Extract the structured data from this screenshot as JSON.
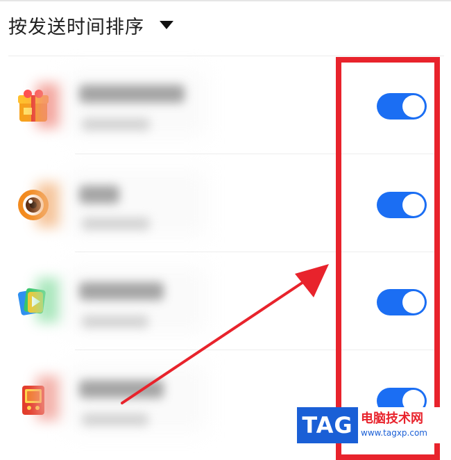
{
  "sort": {
    "label": "按发送时间排序",
    "caret_icon": "caret-down-icon"
  },
  "apps": [
    {
      "icon": "gift-box-app-icon",
      "notifications_enabled": true,
      "accent": "#f5a623"
    },
    {
      "icon": "eye-app-icon",
      "notifications_enabled": true,
      "accent": "#f28a1e"
    },
    {
      "icon": "video-app-icon",
      "notifications_enabled": true,
      "accent": "#37c86a"
    },
    {
      "icon": "red-device-app-icon",
      "notifications_enabled": true,
      "accent": "#e23b2a"
    }
  ],
  "colors": {
    "toggle_on": "#1b6ef3",
    "highlight": "#e8232c",
    "watermark_blue": "#1a5fd6"
  },
  "watermark": {
    "badge": "TAG",
    "title": "电脑技术网",
    "url": "www.tagxp.com"
  }
}
